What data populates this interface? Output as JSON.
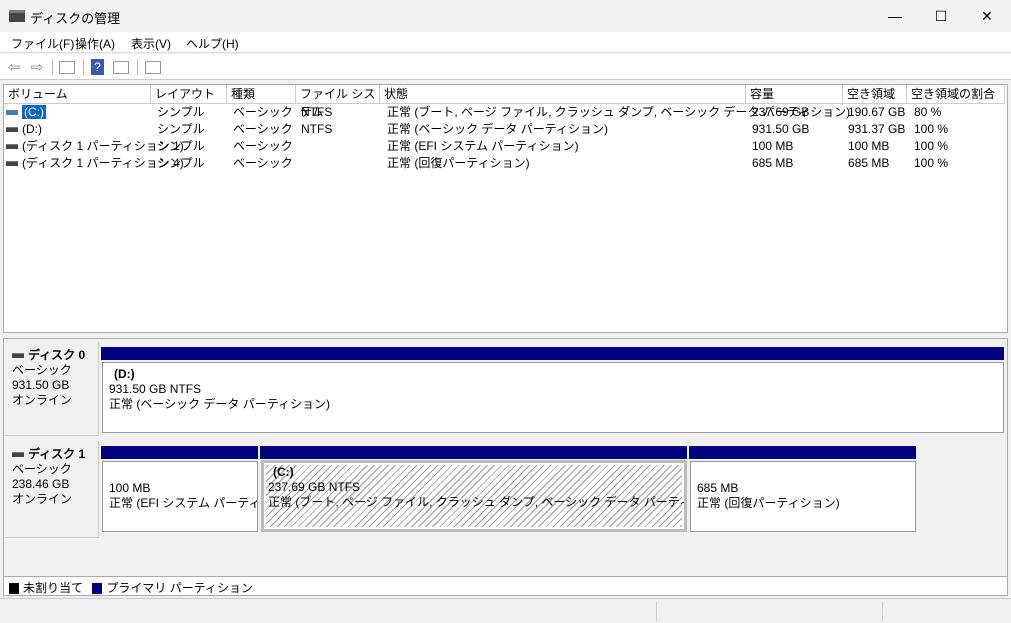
{
  "window": {
    "title": "ディスクの管理",
    "minimize": "—",
    "maximize": "☐",
    "close": "✕"
  },
  "menu": [
    "ファイル(F)",
    "操作(A)",
    "表示(V)",
    "ヘルプ(H)"
  ],
  "toolbar": {
    "back": "⇦",
    "forward": "⇨",
    "help": "?"
  },
  "columns": [
    "ボリューム",
    "レイアウト",
    "種類",
    "ファイル システム",
    "状態",
    "容量",
    "空き領域",
    "空き領域の割合"
  ],
  "rows": [
    {
      "volume": "(C:)",
      "layout": "シンプル",
      "type": "ベーシック",
      "fs": "NTFS",
      "status": "正常 (ブート, ページ ファイル, クラッシュ ダンプ, ベーシック データ パーティション)",
      "capacity": "237.69 GB",
      "free": "190.67 GB",
      "pct": "80 %"
    },
    {
      "volume": "(D:)",
      "layout": "シンプル",
      "type": "ベーシック",
      "fs": "NTFS",
      "status": "正常 (ベーシック データ パーティション)",
      "capacity": "931.50 GB",
      "free": "931.37 GB",
      "pct": "100 %"
    },
    {
      "volume": "(ディスク 1 パーティション 1)",
      "layout": "シンプル",
      "type": "ベーシック",
      "fs": "",
      "status": "正常 (EFI システム パーティション)",
      "capacity": "100 MB",
      "free": "100 MB",
      "pct": "100 %"
    },
    {
      "volume": "(ディスク 1 パーティション 4)",
      "layout": "シンプル",
      "type": "ベーシック",
      "fs": "",
      "status": "正常 (回復パーティション)",
      "capacity": "685 MB",
      "free": "685 MB",
      "pct": "100 %"
    }
  ],
  "disks": [
    {
      "name": "ディスク 0",
      "type": "ベーシック",
      "size": "931.50 GB",
      "state": "オンライン",
      "partitions": [
        {
          "label": "(D:)",
          "size": "931.50 GB NTFS",
          "status": "正常 (ベーシック データ パーティション)"
        }
      ]
    },
    {
      "name": "ディスク 1",
      "type": "ベーシック",
      "size": "238.46 GB",
      "state": "オンライン",
      "partitions": [
        {
          "size": "100 MB",
          "status": "正常 (EFI システム パーティション)"
        },
        {
          "label": "(C:)",
          "size": "237.69 GB NTFS",
          "status": "正常 (ブート, ページ ファイル, クラッシュ ダンプ, ベーシック データ パーティション)"
        },
        {
          "size": "685 MB",
          "status": "正常 (回復パーティション)"
        }
      ]
    }
  ],
  "legend": [
    {
      "label": "未割り当て",
      "color": "#000000"
    },
    {
      "label": "プライマリ パーティション",
      "color": "#000080"
    }
  ]
}
